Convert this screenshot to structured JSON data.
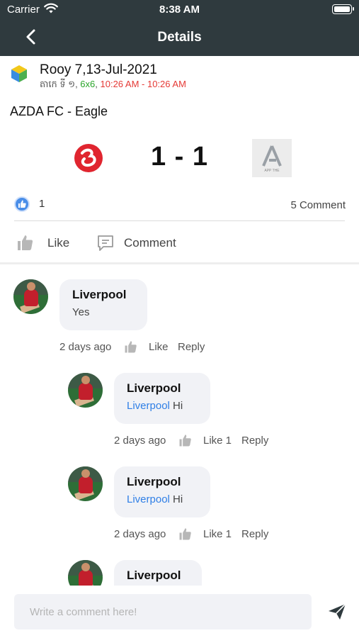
{
  "status": {
    "carrier": "Carrier",
    "time": "8:38 AM"
  },
  "nav": {
    "title": "Details"
  },
  "post": {
    "title": "Rooy 7,13-Jul-2021",
    "meta_prefix": "តាកេ ទី ១, ",
    "meta_format": "6x6",
    "meta_time": "10:26 AM - 10:26 AM",
    "match": "AZDA FC - Eagle",
    "score": "1 - 1",
    "right_team_caption": "APP THE",
    "like_count": "1",
    "comment_count": "5 Comment"
  },
  "actions": {
    "like": "Like",
    "comment": "Comment"
  },
  "colors": {
    "header": "#2f3a3e",
    "accent": "#2f7fe6",
    "green": "#2aa52a",
    "red": "#e53935"
  },
  "comments": [
    {
      "name": "Liverpool",
      "mention": "",
      "text": "Yes",
      "time": "2 days ago",
      "like": "Like",
      "reply": "Reply"
    },
    {
      "name": "Liverpool",
      "mention": "Liverpool",
      "text": " Hi",
      "time": "2 days ago",
      "like": "Like 1",
      "reply": "Reply"
    },
    {
      "name": "Liverpool",
      "mention": "Liverpool",
      "text": " Hi",
      "time": "2 days ago",
      "like": "Like 1",
      "reply": "Reply"
    },
    {
      "name": "Liverpool"
    }
  ],
  "composer": {
    "placeholder": "Write a comment here!"
  },
  "icons": [
    "wifi-icon",
    "battery-icon",
    "back-chevron-icon",
    "app-logo-icon",
    "team-logo-icon",
    "like-bubble-icon",
    "thumb-up-icon",
    "comment-icon",
    "send-icon"
  ]
}
